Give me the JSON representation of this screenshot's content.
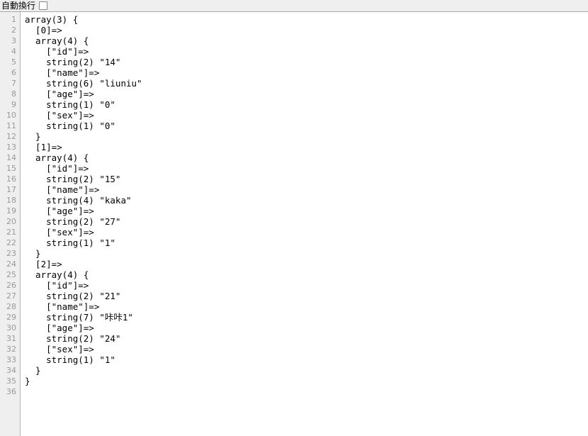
{
  "toolbar": {
    "wrap_label": "自動換行",
    "wrap_checked": false,
    "checkmark": "✓"
  },
  "editor": {
    "total_lines": 36,
    "line_numbers": [
      1,
      2,
      3,
      4,
      5,
      6,
      7,
      8,
      9,
      10,
      11,
      12,
      13,
      14,
      15,
      16,
      17,
      18,
      19,
      20,
      21,
      22,
      23,
      24,
      25,
      26,
      27,
      28,
      29,
      30,
      31,
      32,
      33,
      34,
      35,
      36
    ],
    "lines": [
      "array(3) {",
      "  [0]=>",
      "  array(4) {",
      "    [\"id\"]=>",
      "    string(2) \"14\"",
      "    [\"name\"]=>",
      "    string(6) \"liuniu\"",
      "    [\"age\"]=>",
      "    string(1) \"0\"",
      "    [\"sex\"]=>",
      "    string(1) \"0\"",
      "  }",
      "  [1]=>",
      "  array(4) {",
      "    [\"id\"]=>",
      "    string(2) \"15\"",
      "    [\"name\"]=>",
      "    string(4) \"kaka\"",
      "    [\"age\"]=>",
      "    string(2) \"27\"",
      "    [\"sex\"]=>",
      "    string(1) \"1\"",
      "  }",
      "  [2]=>",
      "  array(4) {",
      "    [\"id\"]=>",
      "    string(2) \"21\"",
      "    [\"name\"]=>",
      "    string(7) \"咔咔1\"",
      "    [\"age\"]=>",
      "    string(2) \"24\"",
      "    [\"sex\"]=>",
      "    string(1) \"1\"",
      "  }",
      "}",
      ""
    ]
  },
  "colors": {
    "toolbar_bg": "#efefef",
    "toolbar_border": "#a9a9a9",
    "gutter_bg": "#efefef",
    "gutter_border": "#b6b6b6",
    "line_number_text": "#999999",
    "code_text": "#000000",
    "editor_bg": "#ffffff"
  }
}
